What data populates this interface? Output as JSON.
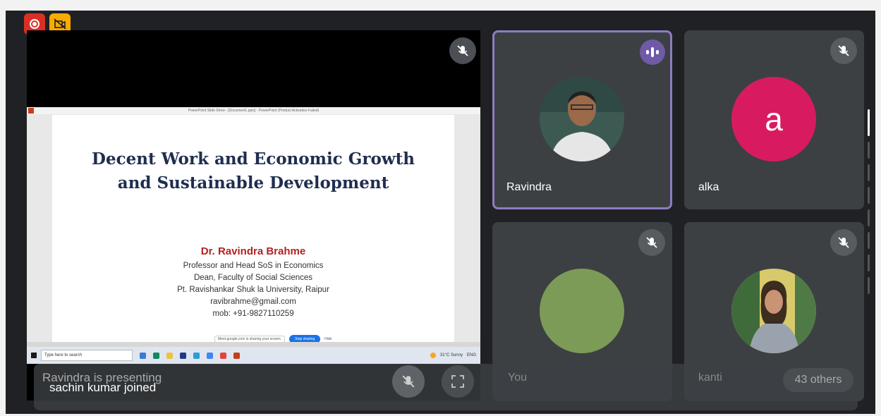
{
  "presentation": {
    "window_title": "PowerPoint Slide Show - [Document1.pptx] - PowerPoint (Product Activation Failed)",
    "slide_title_line1": "Decent Work and Economic Growth",
    "slide_title_line2": "and Sustainable Development",
    "author": "Dr. Ravindra Brahme",
    "lines": [
      "Professor and Head SoS in Economics",
      "Dean, Faculty of Social Sciences",
      "Pt. Ravishankar Shuk la University, Raipur",
      "ravibrahme@gmail.com",
      "mob: +91-9827110259"
    ],
    "share_message": "Meet.google.com is sharing your screen.",
    "stop_sharing": "Stop sharing",
    "hide": "Hide",
    "taskbar_search": "Type here to search",
    "weather": "31°C Sunny",
    "tray_language": "ENG"
  },
  "participants": [
    {
      "name": "Ravindra",
      "muted": false,
      "speaking": true
    },
    {
      "name": "alka",
      "initial": "a",
      "avatar_color": "#d81b60",
      "muted": true
    },
    {
      "name": "You",
      "avatar_color": "#7c9b57",
      "muted": true
    },
    {
      "name": "kanti",
      "muted": true
    }
  ],
  "bottom_bar": {
    "presenting": "Ravindra is presenting",
    "notification": "sachin kumar joined",
    "you_label": "You",
    "kanti_label": "kanti",
    "others": "43 others"
  },
  "colors": {
    "background": "#202124",
    "speaking_border": "#8e7cc3",
    "record": "#d93025"
  }
}
